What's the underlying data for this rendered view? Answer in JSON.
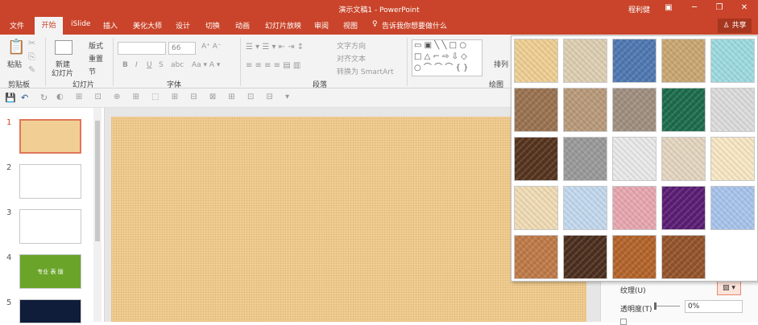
{
  "titlebar": {
    "title": "演示文稿1 - PowerPoint",
    "user": "程利健"
  },
  "tabs": [
    "文件",
    "开始",
    "iSlide",
    "插入",
    "美化大师",
    "设计",
    "切换",
    "动画",
    "幻灯片放映",
    "审阅",
    "视图"
  ],
  "tellme": "告诉我你想要做什么",
  "share": "共享",
  "ribbon": {
    "paste": "粘贴",
    "new_slide": "新建",
    "new_slide2": "幻灯片",
    "layout": "版式",
    "reset": "重置",
    "section": "节",
    "font_size": "66",
    "text_direction": "文字方向",
    "align_text": "对齐文本",
    "convert_smartart": "转换为 SmartArt",
    "arrange": "排列",
    "groups": {
      "clipboard": "剪贴板",
      "slides": "幻灯片",
      "font": "字体",
      "paragraph": "段落",
      "drawing": "绘图"
    }
  },
  "slides": [
    {
      "num": "1",
      "fill": "#f1cf94"
    },
    {
      "num": "2",
      "fill": "#ffffff"
    },
    {
      "num": "3",
      "fill": "#ffffff"
    },
    {
      "num": "4",
      "fill": "#6aa52a",
      "text": "专业 表 版"
    },
    {
      "num": "5",
      "fill": "#0f1c3a"
    }
  ],
  "format_pane": {
    "texture_label": "纹理(U)",
    "transparency_label": "透明度(T)",
    "transparency_value": "0%"
  },
  "textures": [
    [
      "#efcf93",
      "#ddcfb2",
      "#4f78b2",
      "#c9a772",
      "#9ddbe0"
    ],
    [
      "#9a7250",
      "#b99a7a",
      "#a08f80",
      "#1c6c4c",
      "#dcdcdc"
    ],
    [
      "#56341e",
      "#9a9a9a",
      "#e9e9e9",
      "#e4d6c0",
      "#f7e7c4"
    ],
    [
      "#f0dcb5",
      "#c3d9ee",
      "#e8a7b0",
      "#5a1d74",
      "#a8c4ec"
    ],
    [
      "#bf7a48",
      "#4c2f1e",
      "#b4642a",
      "#94542a",
      ""
    ]
  ]
}
